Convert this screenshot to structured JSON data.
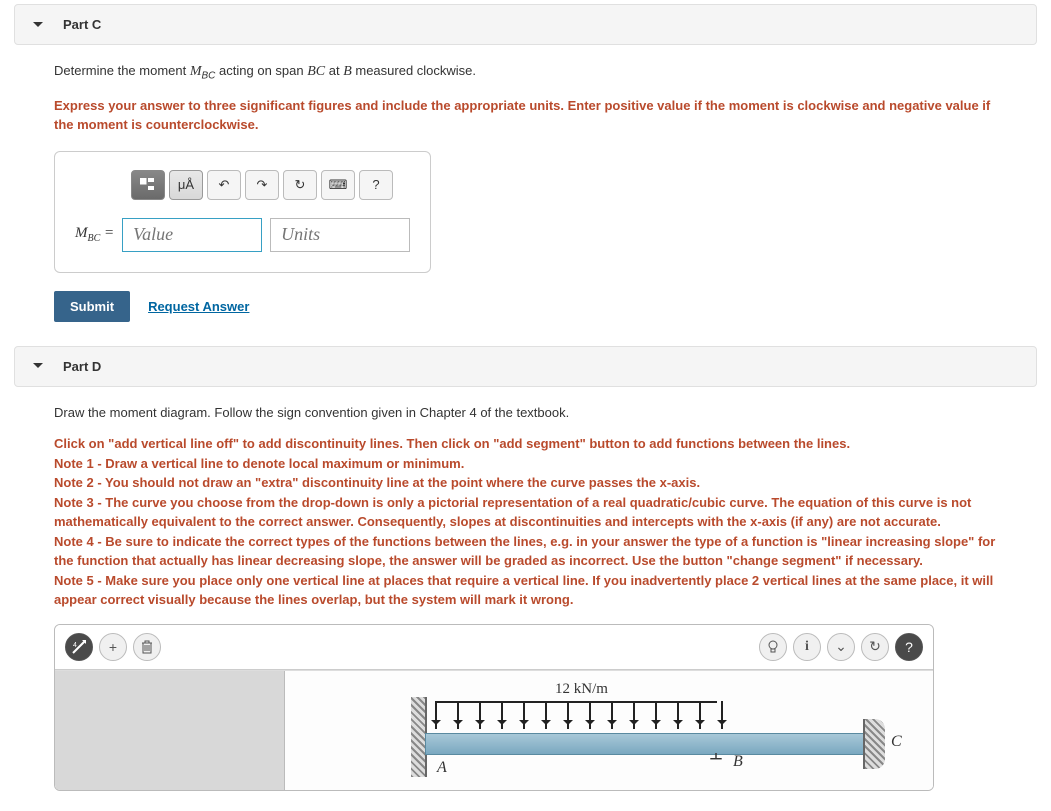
{
  "partC": {
    "title": "Part C",
    "prompt_pre": "Determine the moment ",
    "prompt_var": "M",
    "prompt_sub": "BC",
    "prompt_mid": " acting on span ",
    "prompt_span": "BC",
    "prompt_at": " at ",
    "prompt_point": "B",
    "prompt_post": " measured clockwise.",
    "instructions": "Express your answer to three significant figures and include the appropriate units. Enter positive value if the moment is clockwise and negative value if the moment is counterclockwise.",
    "toolbar": {
      "templates": "⊞",
      "special": "μÅ",
      "undo": "↶",
      "redo": "↷",
      "reset": "↻",
      "keyboard": "⌨",
      "help": "?"
    },
    "var_label": "M",
    "var_sub": "BC",
    "equals": " = ",
    "value_placeholder": "Value",
    "units_placeholder": "Units",
    "submit": "Submit",
    "request": "Request Answer"
  },
  "partD": {
    "title": "Part D",
    "prompt": "Draw the moment diagram. Follow the sign convention given in Chapter 4 of the textbook.",
    "note_intro": "Click on \"add vertical line off\" to add discontinuity lines. Then click on \"add segment\" button to add functions between the lines.",
    "note1": "Note 1 - Draw a vertical line to denote local maximum or minimum.",
    "note2": "Note 2 - You should not draw an \"extra\" discontinuity line at the point where the curve passes the x-axis.",
    "note3": "Note 3 - The curve you choose from the drop-down is only a pictorial representation of a real quadratic/cubic curve. The equation of this curve is not mathematically equivalent to the correct answer. Consequently, slopes at discontinuities and intercepts with the x-axis (if any) are not accurate.",
    "note4": "Note 4 - Be sure to indicate the correct types of the functions between the lines, e.g. in your answer the type of a function is \"linear increasing slope\" for the function that actually has linear decreasing slope, the answer will be graded as incorrect. Use the button \"change segment\" if necessary.",
    "note5": "Note 5 - Make sure you place only one vertical line at places that require a vertical line. If you inadvertently place 2 vertical lines at the same place, it will appear correct visually because the lines overlap, but the system will mark it wrong.",
    "canvas_toolbar": {
      "no_elements": "⊘",
      "add": "+",
      "delete": "🗑",
      "hint": "💡",
      "info": "i",
      "collapse": "⌄",
      "reset": "↻",
      "help": "?"
    },
    "diagram": {
      "load_label": "12 kN/m",
      "pointA": "A",
      "pointB": "B",
      "pointC": "C"
    }
  }
}
